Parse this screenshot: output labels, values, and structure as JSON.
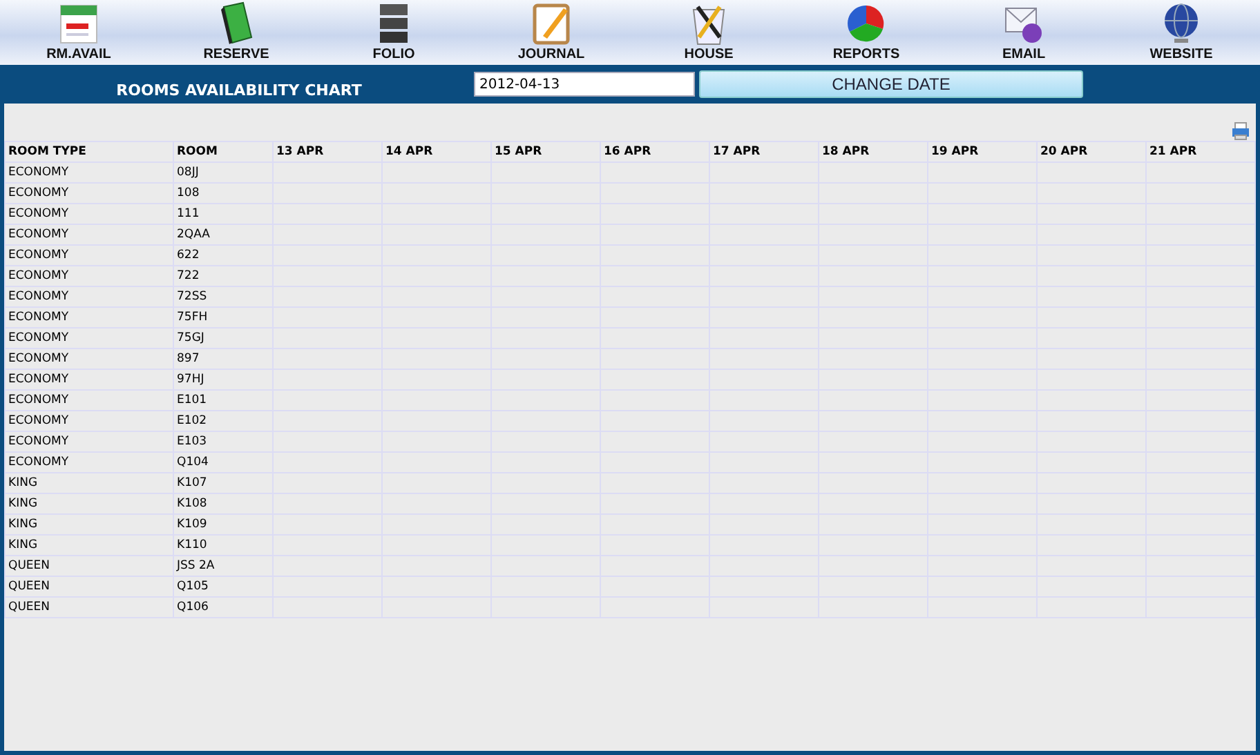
{
  "nav": [
    {
      "kind": "calendar",
      "label": "RM.AVAIL"
    },
    {
      "kind": "book",
      "label": "RESERVE"
    },
    {
      "kind": "stack",
      "label": "FOLIO"
    },
    {
      "kind": "notepad",
      "label": "JOURNAL"
    },
    {
      "kind": "tools",
      "label": "HOUSE"
    },
    {
      "kind": "pie",
      "label": "REPORTS"
    },
    {
      "kind": "envelope",
      "label": "EMAIL"
    },
    {
      "kind": "globe",
      "label": "WEBSITE"
    }
  ],
  "title": "ROOMS AVAILABILITY CHART",
  "date_field": {
    "value": "2012-04-13"
  },
  "change_button": "CHANGE DATE",
  "table": {
    "columns": [
      "ROOM TYPE",
      "ROOM",
      "13 APR",
      "14 APR",
      "15 APR",
      "16 APR",
      "17 APR",
      "18 APR",
      "19 APR",
      "20 APR",
      "21 APR"
    ],
    "rows": [
      [
        "ECONOMY",
        "08JJ"
      ],
      [
        "ECONOMY",
        "108"
      ],
      [
        "ECONOMY",
        "111"
      ],
      [
        "ECONOMY",
        "2QAA"
      ],
      [
        "ECONOMY",
        "622"
      ],
      [
        "ECONOMY",
        "722"
      ],
      [
        "ECONOMY",
        "72SS"
      ],
      [
        "ECONOMY",
        "75FH"
      ],
      [
        "ECONOMY",
        "75GJ"
      ],
      [
        "ECONOMY",
        "897"
      ],
      [
        "ECONOMY",
        "97HJ"
      ],
      [
        "ECONOMY",
        "E101"
      ],
      [
        "ECONOMY",
        "E102"
      ],
      [
        "ECONOMY",
        "E103"
      ],
      [
        "ECONOMY",
        "Q104"
      ],
      [
        "KING",
        "K107"
      ],
      [
        "KING",
        "K108"
      ],
      [
        "KING",
        "K109"
      ],
      [
        "KING",
        "K110"
      ],
      [
        "QUEEN",
        "JSS 2A"
      ],
      [
        "QUEEN",
        "Q105"
      ],
      [
        "QUEEN",
        "Q106"
      ]
    ]
  }
}
